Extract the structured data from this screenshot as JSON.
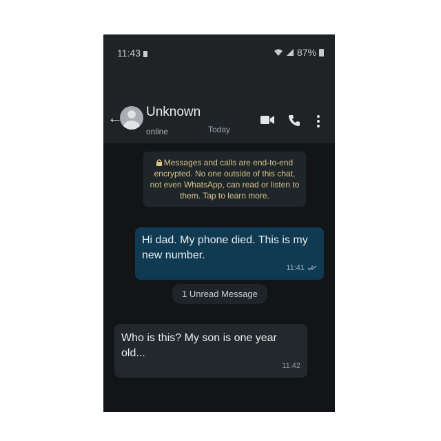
{
  "statusbar": {
    "time": "11:43",
    "battery": "87%"
  },
  "header": {
    "contact_name": "Unknown",
    "contact_status": "online",
    "icons": [
      "back-arrow-icon",
      "video-call-icon",
      "phone-call-icon",
      "more-options-icon"
    ]
  },
  "chat": {
    "date_label": "Today",
    "encryption_notice": "Messages and calls are end-to-end encrypted. No one outside of this chat, not even WhatsApp, can read or listen to them. Tap to learn more.",
    "unread_label": "1 Unread Message",
    "messages": [
      {
        "direction": "outgoing",
        "text": "Hi dad. My phone died. This is my new number.",
        "time": "11:41"
      },
      {
        "direction": "incoming",
        "text": "Who is this? My son is one year old...",
        "time": "11:42"
      }
    ]
  },
  "colors": {
    "header_bg": "#202326",
    "chat_bg": "#121417",
    "outgoing_bubble": "#0f3a52",
    "incoming_bubble": "#23282c",
    "notice_text": "#d8c38a"
  }
}
